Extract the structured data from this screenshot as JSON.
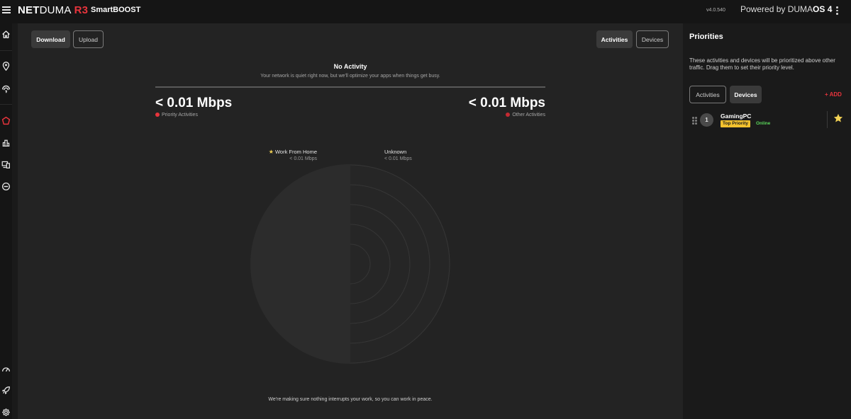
{
  "header": {
    "logo_net": "NET",
    "logo_duma": "DUMA",
    "logo_model": "R3",
    "app_name": "SmartBOOST",
    "version": "v4.0.540",
    "powered_prefix": "Powered by DUMA",
    "powered_os": "OS 4"
  },
  "main": {
    "tabs": {
      "download": "Download",
      "upload": "Upload"
    },
    "view": {
      "activities": "Activities",
      "devices": "Devices"
    },
    "status_title": "No Activity",
    "status_sub": "Your network is quiet right now, but we'll optimize your apps when things get busy.",
    "priority_value": "< 0.01 Mbps",
    "priority_label": "Priority Activities",
    "other_value": "< 0.01 Mbps",
    "other_label": "Other Activities",
    "segments": [
      {
        "name": "Work From Home",
        "value": "< 0.01 Mbps"
      },
      {
        "name": "Unknown",
        "value": "< 0.01 Mbps"
      }
    ],
    "footer": "We're making sure nothing interrupts your work, so you can work in peace."
  },
  "panel": {
    "title": "Priorities",
    "description": "These activities and devices will be prioritized above other traffic. Drag them to set their priority level.",
    "tabs": {
      "activities": "Activities",
      "devices": "Devices"
    },
    "add_label": "+ ADD",
    "devices": [
      {
        "rank": "1",
        "name": "GamingPC",
        "badge": "Top Priority",
        "status": "Online"
      }
    ]
  },
  "colors": {
    "accent": "#e8343c",
    "gold": "#f2c12e",
    "online": "#5ad65a"
  }
}
